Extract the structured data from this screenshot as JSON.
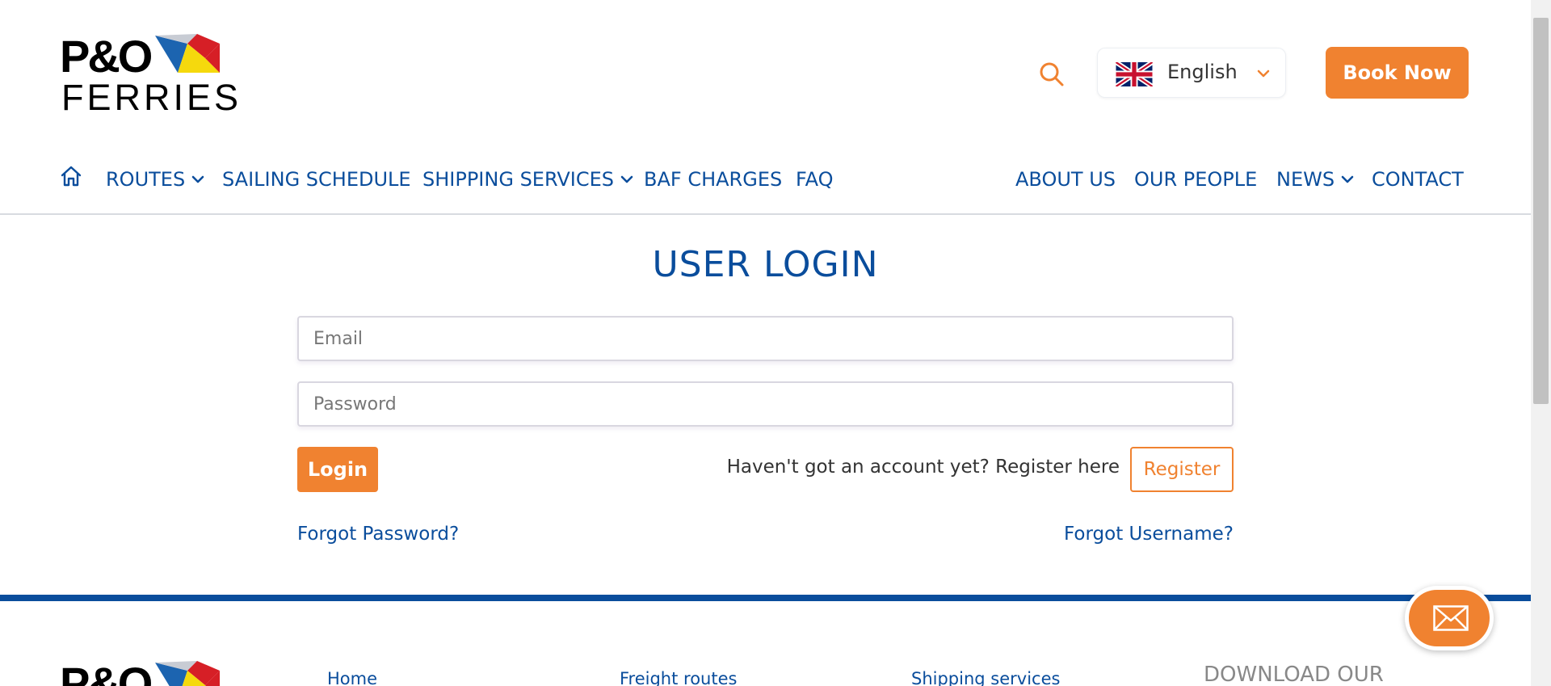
{
  "header": {
    "logo_word1": "P&O",
    "logo_word2": "FERRIES",
    "language": "English",
    "book_now": "Book Now"
  },
  "nav": {
    "left": [
      {
        "label": "ROUTES",
        "dropdown": true
      },
      {
        "label": "SAILING SCHEDULE",
        "dropdown": false
      },
      {
        "label": "SHIPPING SERVICES",
        "dropdown": true
      },
      {
        "label": "BAF CHARGES",
        "dropdown": false
      },
      {
        "label": "FAQ",
        "dropdown": false
      }
    ],
    "right": [
      {
        "label": "ABOUT US",
        "dropdown": false
      },
      {
        "label": "OUR PEOPLE",
        "dropdown": false
      },
      {
        "label": "NEWS",
        "dropdown": true
      },
      {
        "label": "CONTACT",
        "dropdown": false
      }
    ]
  },
  "login": {
    "title": "USER LOGIN",
    "email_placeholder": "Email",
    "password_placeholder": "Password",
    "login_button": "Login",
    "register_prompt": "Haven't got an account yet? Register here",
    "register_button": "Register",
    "forgot_password": "Forgot Password?",
    "forgot_username": "Forgot Username?"
  },
  "footer": {
    "links": [
      "Home",
      "Freight routes",
      "Shipping services"
    ],
    "download_heading": "DOWNLOAD OUR"
  },
  "colors": {
    "brand_blue": "#0a4d9c",
    "accent_orange": "#f08230"
  },
  "icons": [
    "search-icon",
    "uk-flag-icon",
    "chevron-down-icon",
    "home-icon",
    "mail-icon"
  ]
}
